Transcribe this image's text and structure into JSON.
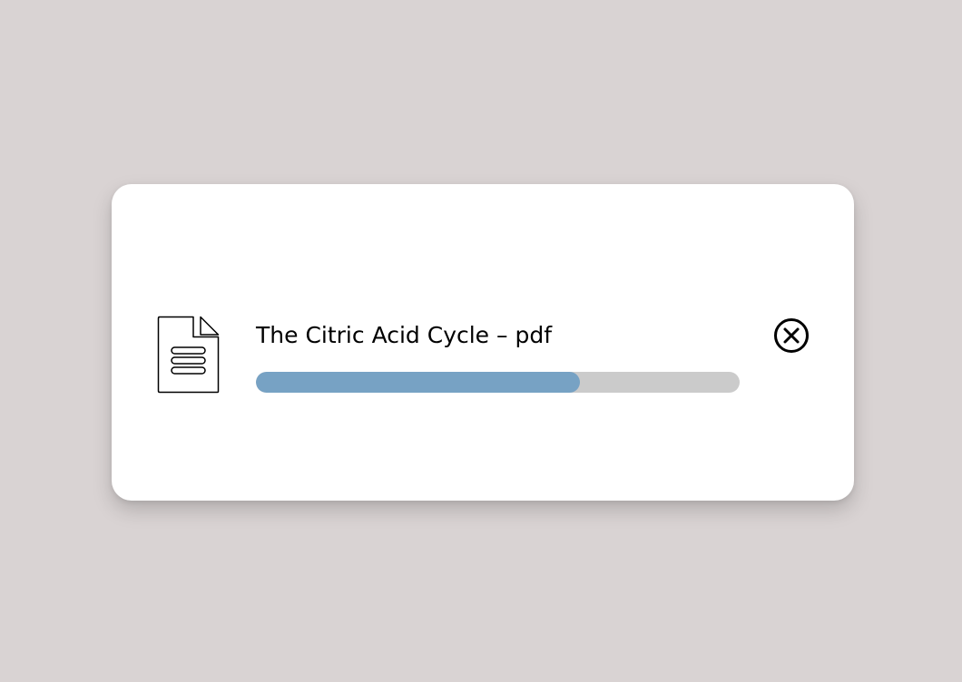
{
  "upload": {
    "file_name": "The Citric Acid Cycle – pdf",
    "progress": 0.67,
    "file_icon": "document-icon",
    "close_icon": "close-circle-icon"
  },
  "colors": {
    "background": "#d9d3d3",
    "card": "#ffffff",
    "progress_fill": "#77a2c4",
    "progress_track": "#cbcbcb"
  }
}
